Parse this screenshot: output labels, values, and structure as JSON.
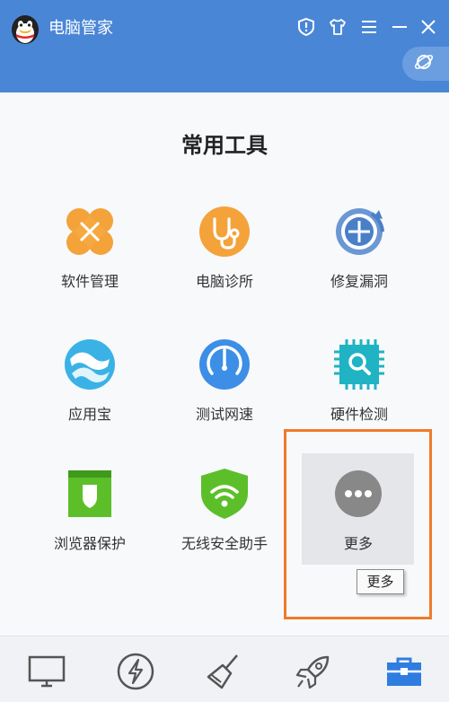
{
  "window": {
    "title": "电脑管家",
    "titlebar_color": "#4a86d6",
    "icons": [
      "shield-icon",
      "tshirt-icon",
      "menu-icon",
      "minimize-icon",
      "close-icon"
    ]
  },
  "section": {
    "title": "常用工具"
  },
  "tools": [
    {
      "label": "软件管理",
      "icon": "clover-icon",
      "color": "#f4a23a"
    },
    {
      "label": "电脑诊所",
      "icon": "stethoscope-icon",
      "color": "#f4a23a"
    },
    {
      "label": "修复漏洞",
      "icon": "repair-icon",
      "color": "#4a7fc8"
    },
    {
      "label": "应用宝",
      "icon": "app-store-icon",
      "color": "#3bb2e6"
    },
    {
      "label": "测试网速",
      "icon": "speedometer-icon",
      "color": "#3d8ee6"
    },
    {
      "label": "硬件检测",
      "icon": "chip-icon",
      "color": "#1fb3c4"
    },
    {
      "label": "浏览器保护",
      "icon": "browser-shield-icon",
      "color": "#5cbf2a"
    },
    {
      "label": "无线安全助手",
      "icon": "wifi-shield-icon",
      "color": "#5cbf2a"
    },
    {
      "label": "更多",
      "icon": "more-icon",
      "color": "#888888"
    }
  ],
  "tooltip": {
    "text": "更多"
  },
  "accent": {
    "highlight_frame": "#ef7a2c",
    "active_tab": "#2f7de1"
  },
  "bottom_nav": [
    "monitor-icon",
    "lightning-icon",
    "broom-icon",
    "rocket-icon",
    "toolbox-icon"
  ]
}
